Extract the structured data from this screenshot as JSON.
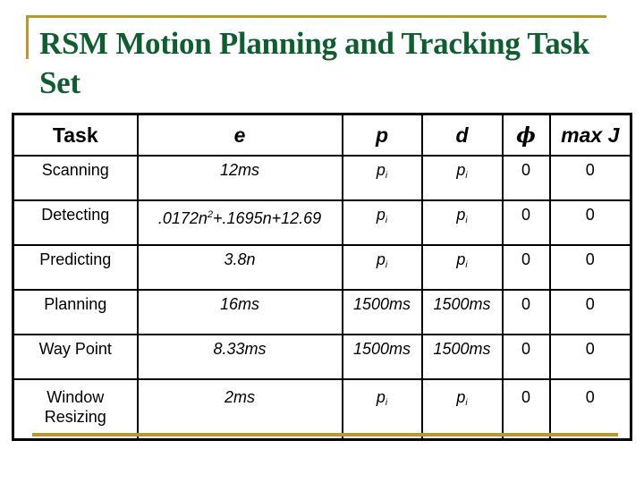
{
  "slide": {
    "title": "RSM Motion Planning and Tracking Task Set",
    "accent_color": "#b89a2c",
    "title_color": "#0e5e32"
  },
  "table": {
    "headers": {
      "task": "Task",
      "e": "e",
      "p": "p",
      "d": "d",
      "phi": "ϕ",
      "maxj": "max J"
    },
    "rows": [
      {
        "task": "Scanning",
        "e": "12ms",
        "p_base": "p",
        "p_sub": "i",
        "d_base": "p",
        "d_sub": "i",
        "phi": "0",
        "maxj": "0"
      },
      {
        "task": "Detecting",
        "e_part1": ".0172n",
        "e_sup": "2",
        "e_part2": "+.1695n+12.69",
        "p_base": "p",
        "p_sub": "i",
        "d_base": "p",
        "d_sub": "i",
        "phi": "0",
        "maxj": "0"
      },
      {
        "task": "Predicting",
        "e": "3.8n",
        "p_base": "p",
        "p_sub": "i",
        "d_base": "p",
        "d_sub": "i",
        "phi": "0",
        "maxj": "0"
      },
      {
        "task": "Planning",
        "e": "16ms",
        "p": "1500ms",
        "d": "1500ms",
        "phi": "0",
        "maxj": "0"
      },
      {
        "task": "Way Point",
        "e": "8.33ms",
        "p": "1500ms",
        "d": "1500ms",
        "phi": "0",
        "maxj": "0"
      },
      {
        "task": "Window Resizing",
        "task_line1": "Window",
        "task_line2": "Resizing",
        "e": "2ms",
        "p_base": "p",
        "p_sub": "i",
        "d_base": "p",
        "d_sub": "i",
        "phi": "0",
        "maxj": "0"
      }
    ]
  }
}
